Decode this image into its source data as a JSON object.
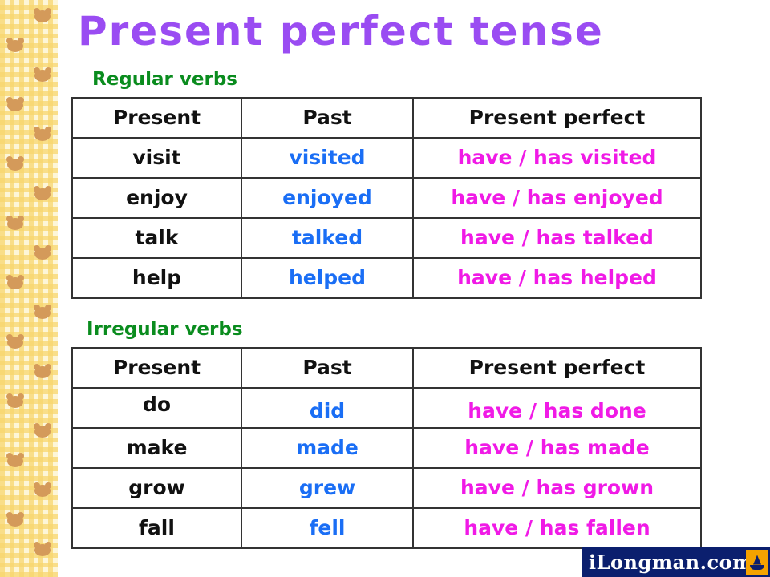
{
  "title": "Present perfect tense",
  "colors": {
    "title": "#9a4cf2",
    "section": "#0a8c1e",
    "present": "#111111",
    "past": "#1a6ef5",
    "perfect": "#f01ae6"
  },
  "regular": {
    "heading": "Regular verbs",
    "columns": [
      "Present",
      "Past",
      "Present perfect"
    ],
    "rows": [
      [
        "visit",
        "visited",
        "have / has visited"
      ],
      [
        "enjoy",
        "enjoyed",
        "have / has enjoyed"
      ],
      [
        "talk",
        "talked",
        "have / has talked"
      ],
      [
        "help",
        "helped",
        "have / has helped"
      ]
    ]
  },
  "irregular": {
    "heading": "Irregular verbs",
    "columns": [
      "Present",
      "Past",
      "Present perfect"
    ],
    "rows": [
      [
        "do",
        "did",
        "have / has done"
      ],
      [
        "make",
        "made",
        "have / has made"
      ],
      [
        "grow",
        "grew",
        "have / has grown"
      ],
      [
        "fall",
        "fell",
        "have / has fallen"
      ]
    ]
  },
  "logo": {
    "text": "iLongman.com",
    "icon": "ship-icon"
  },
  "decoration": {
    "icon": "bear-icon",
    "pattern": "yellow-gingham"
  }
}
